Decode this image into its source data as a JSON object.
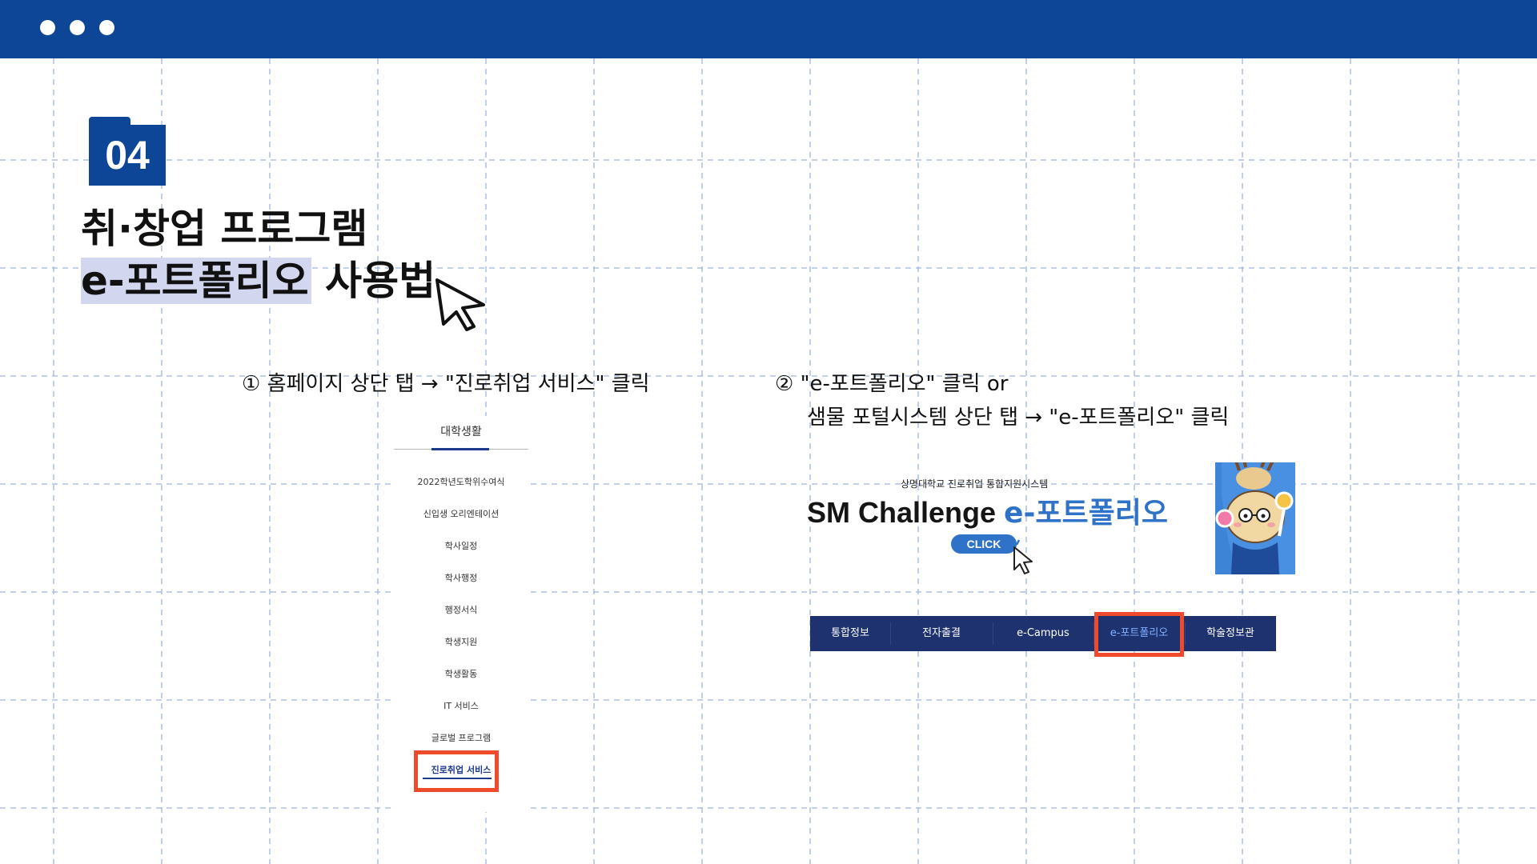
{
  "window": {
    "dots": 3
  },
  "section": {
    "number": "04"
  },
  "title": {
    "line1": "취·창업 프로그램",
    "line2_highlight": "e-포트폴리오",
    "line2_rest": " 사용법"
  },
  "steps": {
    "step1": "① 홈페이지 상단 탭 → \"진로취업 서비스\" 클릭",
    "step2_line1": "② \"e-포트폴리오\" 클릭 or",
    "step2_line2": "샘물 포털시스템 상단 탭 → \"e-포트폴리오\" 클릭"
  },
  "menu": {
    "header": "대학생활",
    "items": [
      "2022학년도학위수여식",
      "신입생 오리엔테이션",
      "학사일정",
      "학사행정",
      "행정서식",
      "학생지원",
      "학생활동",
      "IT 서비스",
      "글로벌 프로그램",
      "진로취업 서비스"
    ],
    "active_index": 9
  },
  "banner": {
    "subtitle": "상명대학교 진로취업 통합지원시스템",
    "title_main": "SM Challenge ",
    "title_accent": "e-포트폴리오",
    "click_label": "CLICK"
  },
  "navbar": {
    "items": [
      "통합정보",
      "전자출결",
      "e-Campus",
      "e-포트폴리오",
      "학술정보관"
    ],
    "active_index": 3
  },
  "colors": {
    "brand_blue": "#0d4697",
    "highlight": "#d3d6ef",
    "red_outline": "#ef4a2b",
    "nav_bg": "#1f3270",
    "accent_blue": "#2f73c8",
    "grid_line": "#9fb5de"
  }
}
